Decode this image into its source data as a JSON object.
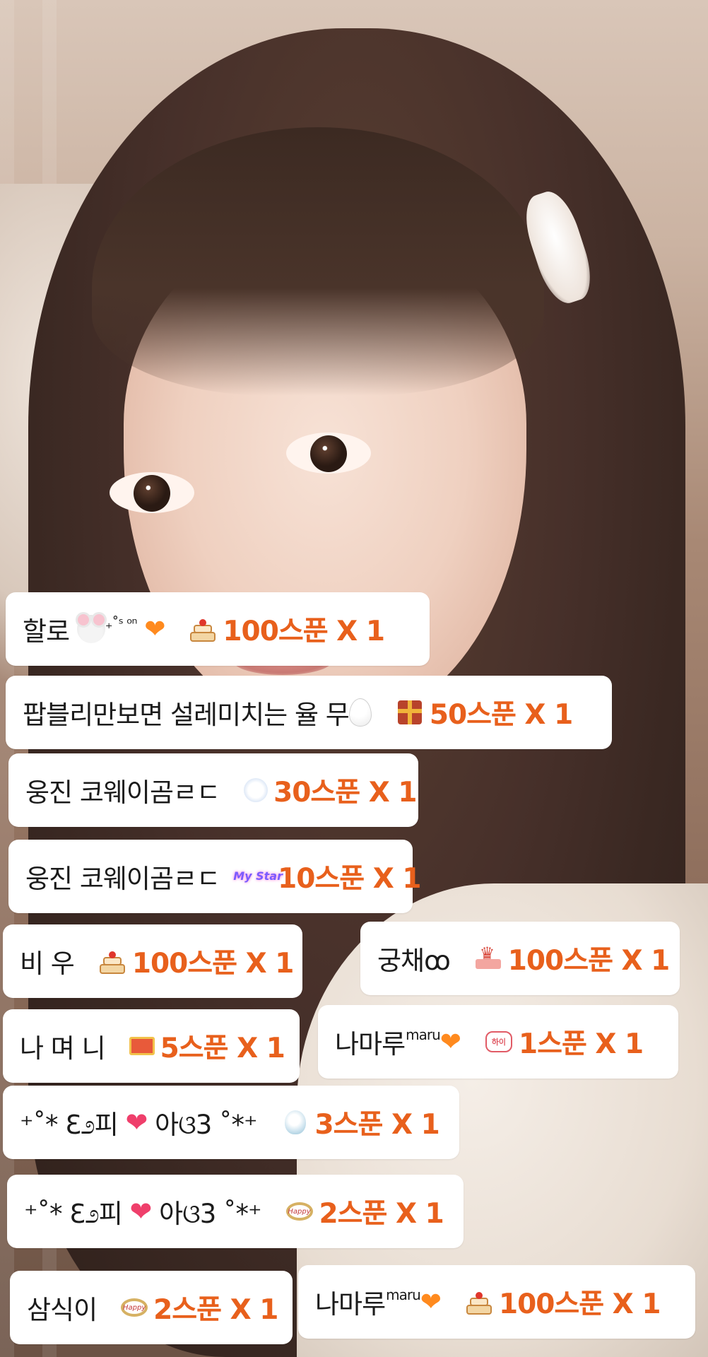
{
  "gift_feed": [
    {
      "nick_text": "할로",
      "nick_suffix": "₊˚ˢ ᵒⁿ",
      "icon": "cake-icon",
      "amount": "100스푼 X 1"
    },
    {
      "nick_text": "팝블리만보면 설레미치는 율 무",
      "icon": "gift-box-icon",
      "amount": "50스푼 X 1"
    },
    {
      "nick_text": "웅진 코웨이곰ㄹㄷ",
      "icon": "bear-icon",
      "amount": "30스푼 X 1"
    },
    {
      "nick_text": "웅진 코웨이곰ㄹㄷ",
      "icon": "my-star-icon",
      "icon_text": "My Star",
      "amount": "10스푼 X 1"
    },
    {
      "nick_text": "비 우",
      "icon": "cake-icon",
      "amount": "100스푼 X 1"
    },
    {
      "nick_text": "궁채ꝏ",
      "icon": "crown-cake-icon",
      "amount": "100스푼 X 1"
    },
    {
      "nick_text": "나 며 니",
      "icon": "treasure-box-icon",
      "amount": "5스푼 X 1"
    },
    {
      "nick_text": "나마루",
      "nick_sup": "maru",
      "icon": "speech-bubble-icon",
      "icon_text": "하이",
      "amount": "1스푼 X 1"
    },
    {
      "nick_text_a": "⁺˚* ℇ೨피",
      "nick_text_b": "아ଓ3 ˚*⁺",
      "icon": "snow-globe-icon",
      "amount": "3스푼 X 1"
    },
    {
      "nick_text_a": "⁺˚* ℇ೨피",
      "nick_text_b": "아ଓ3 ˚*⁺",
      "icon": "happy-wreath-icon",
      "icon_text": "Happy",
      "amount": "2스푼 X 1"
    },
    {
      "nick_text": "삼식이",
      "icon": "happy-wreath-icon",
      "icon_text": "Happy",
      "amount": "2스푼 X 1"
    },
    {
      "nick_text": "나마루",
      "nick_sup": "maru",
      "icon": "cake-icon",
      "amount": "100스푼 X 1"
    }
  ],
  "colors": {
    "amount_text": "#e8601c",
    "bubble_bg": "#ffffff",
    "nick_text": "#1b1b1b"
  }
}
